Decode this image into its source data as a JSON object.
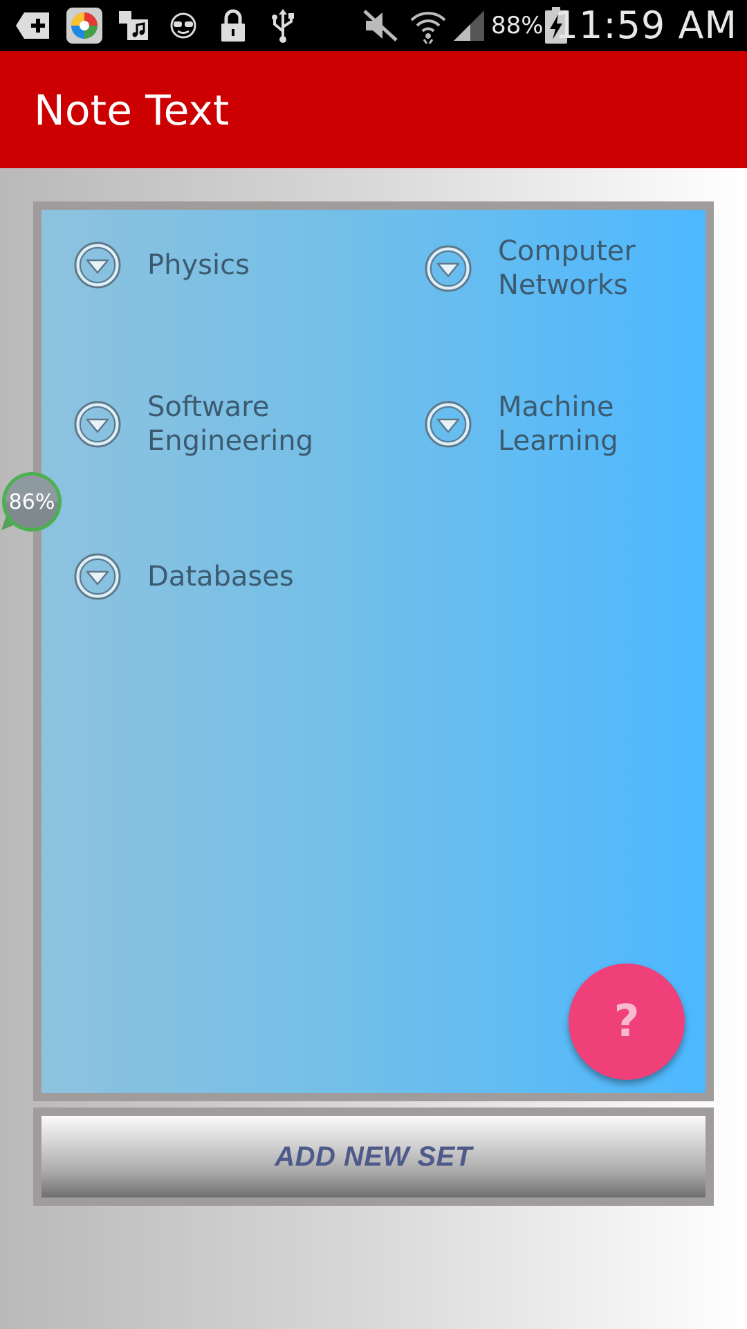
{
  "status_bar": {
    "battery_percent": "88%",
    "time": "11:59 AM",
    "icons": [
      "add-notification-icon",
      "colorful-app-icon",
      "music-file-icon",
      "sunglasses-icon",
      "lock-icon",
      "usb-icon",
      "mute-icon",
      "wifi-icon",
      "signal-icon",
      "battery-charging-icon"
    ]
  },
  "app_bar": {
    "title": "Note Text"
  },
  "sets": [
    {
      "label": "Physics",
      "icon": "chevron-down-circle-icon"
    },
    {
      "label": "Computer\nNetworks",
      "icon": "chevron-down-circle-icon"
    },
    {
      "label": "Software\nEngineering",
      "icon": "chevron-down-circle-icon"
    },
    {
      "label": "Machine\nLearning",
      "icon": "chevron-down-circle-icon"
    },
    {
      "label": "Databases",
      "icon": "chevron-down-circle-icon"
    }
  ],
  "fab": {
    "label": "?",
    "color": "#f0407a"
  },
  "add_button": {
    "label": "ADD NEW SET"
  },
  "floating_indicator": {
    "value": "86%"
  },
  "colors": {
    "app_bar": "#cc0000",
    "panel_start": "#8ec2de",
    "panel_end": "#4db8ff"
  }
}
